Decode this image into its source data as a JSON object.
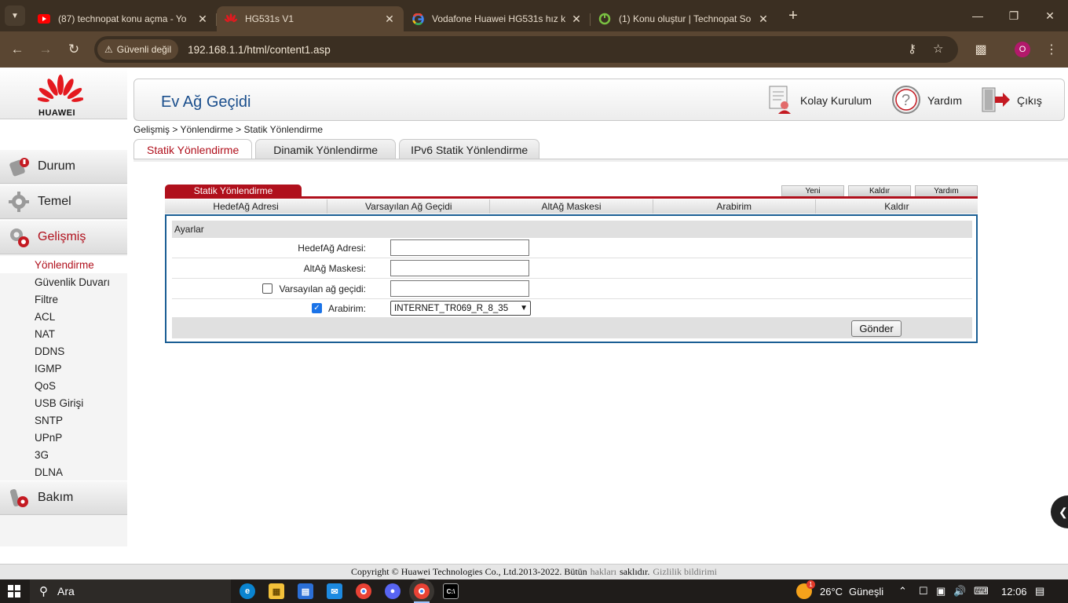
{
  "browser": {
    "tabs": [
      {
        "title": "(87) technopat konu açma - Yo",
        "icon": "youtube-icon"
      },
      {
        "title": "HG531s V1",
        "icon": "huawei-icon",
        "active": true
      },
      {
        "title": "Vodafone Huawei HG531s hız k",
        "icon": "google-icon"
      },
      {
        "title": "(1) Konu oluştur | Technopat So",
        "icon": "technopat-icon"
      }
    ],
    "security_label": "Güvenli değil",
    "url": "192.168.1.1/html/content1.asp",
    "profile_initial": "O"
  },
  "logo": {
    "brand": "HUAWEI"
  },
  "header": {
    "title": "Ev Ağ Geçidi",
    "actions": [
      {
        "label": "Kolay Kurulum",
        "icon": "setup-wizard-icon"
      },
      {
        "label": "Yardım",
        "icon": "help-icon"
      },
      {
        "label": "Çıkış",
        "icon": "logout-icon"
      }
    ]
  },
  "sidebar": {
    "menus": [
      {
        "label": "Durum",
        "icon": "status-icon"
      },
      {
        "label": "Temel",
        "icon": "basic-settings-icon"
      },
      {
        "label": "Gelişmiş",
        "icon": "advanced-icon",
        "active": true
      },
      {
        "label": "Bakım",
        "icon": "maintenance-icon"
      }
    ],
    "submenu": [
      "Yönlendirme",
      "Güvenlik Duvarı",
      "Filtre",
      "ACL",
      "NAT",
      "DDNS",
      "IGMP",
      "QoS",
      "USB Girişi",
      "SNTP",
      "UPnP",
      "3G",
      "DLNA"
    ],
    "active_submenu": "Yönlendirme"
  },
  "breadcrumb": "Gelişmiş > Yönlendirme > Statik Yönlendirme",
  "page_tabs": [
    "Statik Yönlendirme",
    "Dinamik Yönlendirme",
    "IPv6 Statik Yönlendirme"
  ],
  "section": {
    "title": "Statik Yönlendirme",
    "buttons": [
      "Yeni",
      "Kaldır",
      "Yardım"
    ],
    "columns": [
      "HedefAğ Adresi",
      "Varsayılan Ağ Geçidi",
      "AltAğ Maskesi",
      "Arabirim",
      "Kaldır"
    ]
  },
  "form": {
    "group_label": "Ayarlar",
    "dest_label": "HedefAğ Adresi:",
    "dest_value": "",
    "mask_label": "AltAğ Maskesi:",
    "mask_value": "",
    "gateway_label": "Varsayılan ağ geçidi:",
    "gateway_checked": false,
    "gateway_value": "",
    "interface_label": "Arabirim:",
    "interface_checked": true,
    "interface_value": "INTERNET_TR069_R_8_35",
    "submit_label": "Gönder"
  },
  "footer": {
    "copyright": "Copyright © Huawei Technologies Co., Ltd.2013-2022. Bütün",
    "rights": "hakları",
    "reserved": "saklıdır.",
    "privacy": "Gizlilik bildirimi"
  },
  "taskbar": {
    "search_label": "Ara",
    "weather": "26°C",
    "weather_desc": "Güneşli",
    "weather_badge": "1",
    "clock": "12:06"
  },
  "colors": {
    "accent_red": "#b0101c",
    "title_blue": "#1a4e8c",
    "browser_dark": "#3b2f22",
    "browser_mid": "#5a4632"
  }
}
